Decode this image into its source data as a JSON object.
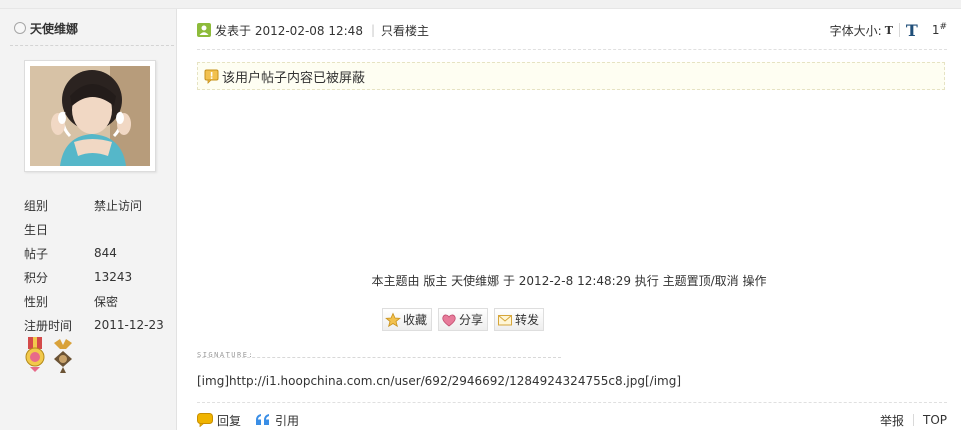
{
  "user": {
    "name": "天使维娜",
    "profile": [
      {
        "label": "组别",
        "value": "禁止访问"
      },
      {
        "label": "生日",
        "value": ""
      },
      {
        "label": "帖子",
        "value": "844"
      },
      {
        "label": "积分",
        "value": "13243"
      },
      {
        "label": "性别",
        "value": "保密"
      },
      {
        "label": "注册时间",
        "value": "2011-12-23"
      }
    ],
    "medal_icons": [
      "rank-medal-icon",
      "badge-medal-icon"
    ]
  },
  "post": {
    "date": "发表于 2012-02-08 12:48",
    "only_op": "只看楼主",
    "font_size_label": "字体大小:",
    "font_small": "T",
    "font_large": "T",
    "floor_number": "1",
    "floor_mark": "#",
    "notice": "该用户帖子内容已被屏蔽",
    "mod_info": "本主题由 版主 天使维娜 于 2012-2-8 12:48:29 执行 主题置顶/取消 操作",
    "actions": {
      "favorite": "收藏",
      "share": "分享",
      "forward": "转发"
    },
    "signature_label": "SIGNATURE:",
    "signature": "[img]http://i1.hoopchina.com.cn/user/692/2946692/1284924324755c8.jpg[/img]"
  },
  "footer": {
    "reply": "回复",
    "quote": "引用",
    "report": "举报",
    "top": "TOP"
  },
  "colors": {
    "sidebar_bg": "#f3f3f3",
    "notice_bg": "#fefef2",
    "font_large": "#1f4e79",
    "accent_icon": "#f0b400",
    "quote_icon": "#3a8ee6"
  }
}
